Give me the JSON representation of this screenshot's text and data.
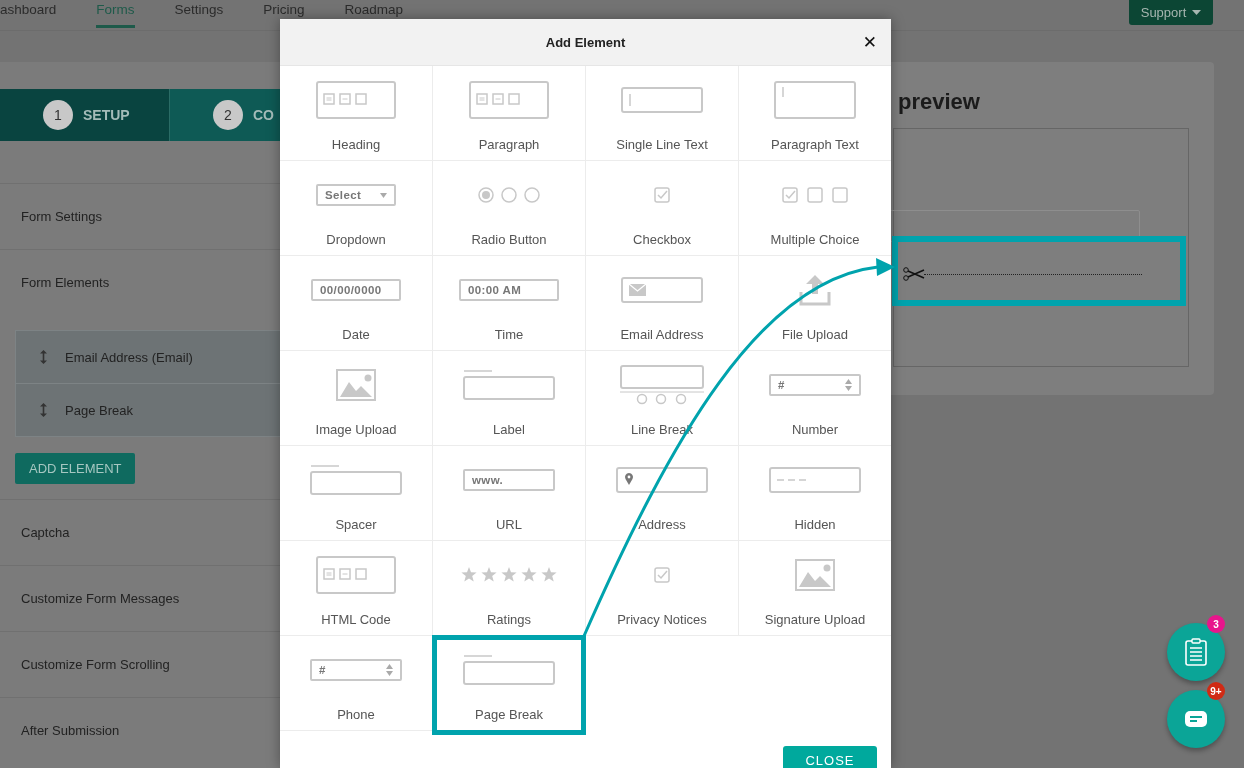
{
  "nav": {
    "items": [
      {
        "label": "ashboard",
        "selected": false
      },
      {
        "label": "Forms",
        "selected": true
      },
      {
        "label": "Settings",
        "selected": false
      },
      {
        "label": "Pricing",
        "selected": false
      },
      {
        "label": "Roadmap",
        "selected": false
      }
    ],
    "support": "Support"
  },
  "steps": [
    {
      "number": "1",
      "label": "SETUP",
      "selected": true
    },
    {
      "number": "2",
      "label": "CO",
      "selected": false
    }
  ],
  "sidebar": {
    "sections_top": [
      "Form Settings",
      "Form Elements"
    ],
    "elements": [
      "Email Address (Email)",
      "Page Break"
    ],
    "add_button": "ADD ELEMENT",
    "sections_bottom": [
      "Captcha",
      "Customize Form Messages",
      "Customize Form Scrolling",
      "After Submission"
    ]
  },
  "preview": {
    "title": "preview"
  },
  "modal": {
    "title": "Add Element",
    "close_symbol": "✕",
    "close_button": "CLOSE",
    "tiles": [
      {
        "kind": "heading",
        "label": "Heading",
        "highlighted": false
      },
      {
        "kind": "paragraph",
        "label": "Paragraph",
        "highlighted": false
      },
      {
        "kind": "single-line",
        "label": "Single Line Text",
        "highlighted": false
      },
      {
        "kind": "paragraph-text",
        "label": "Paragraph Text",
        "highlighted": false
      },
      {
        "kind": "dropdown",
        "label": "Dropdown",
        "icon_text": "Select",
        "highlighted": false
      },
      {
        "kind": "radio",
        "label": "Radio Button",
        "highlighted": false
      },
      {
        "kind": "checkbox",
        "label": "Checkbox",
        "highlighted": false
      },
      {
        "kind": "multiple-choice",
        "label": "Multiple Choice",
        "highlighted": false
      },
      {
        "kind": "date",
        "label": "Date",
        "icon_text": "00/00/0000",
        "highlighted": false
      },
      {
        "kind": "time",
        "label": "Time",
        "icon_text": "00:00 AM",
        "highlighted": false
      },
      {
        "kind": "email",
        "label": "Email Address",
        "highlighted": false
      },
      {
        "kind": "file-upload",
        "label": "File Upload",
        "highlighted": false
      },
      {
        "kind": "image-upload",
        "label": "Image Upload",
        "highlighted": false
      },
      {
        "kind": "label",
        "label": "Label",
        "highlighted": false
      },
      {
        "kind": "line-break",
        "label": "Line Break",
        "highlighted": false
      },
      {
        "kind": "number",
        "label": "Number",
        "icon_text": "#",
        "highlighted": false
      },
      {
        "kind": "spacer",
        "label": "Spacer",
        "highlighted": false
      },
      {
        "kind": "url",
        "label": "URL",
        "icon_text": "www.",
        "highlighted": false
      },
      {
        "kind": "address",
        "label": "Address",
        "highlighted": false
      },
      {
        "kind": "hidden",
        "label": "Hidden",
        "highlighted": false
      },
      {
        "kind": "html",
        "label": "HTML Code",
        "highlighted": false
      },
      {
        "kind": "ratings",
        "label": "Ratings",
        "highlighted": false
      },
      {
        "kind": "privacy",
        "label": "Privacy Notices",
        "highlighted": false
      },
      {
        "kind": "signature",
        "label": "Signature Upload",
        "highlighted": false
      },
      {
        "kind": "phone",
        "label": "Phone",
        "icon_text": "#",
        "highlighted": false
      },
      {
        "kind": "page-break",
        "label": "Page Break",
        "highlighted": true
      }
    ]
  },
  "fabs": [
    {
      "kind": "clipboard",
      "badge": "3",
      "color": "#e8158c"
    },
    {
      "kind": "chat",
      "badge": "9+",
      "color": "#d02a14"
    }
  ]
}
